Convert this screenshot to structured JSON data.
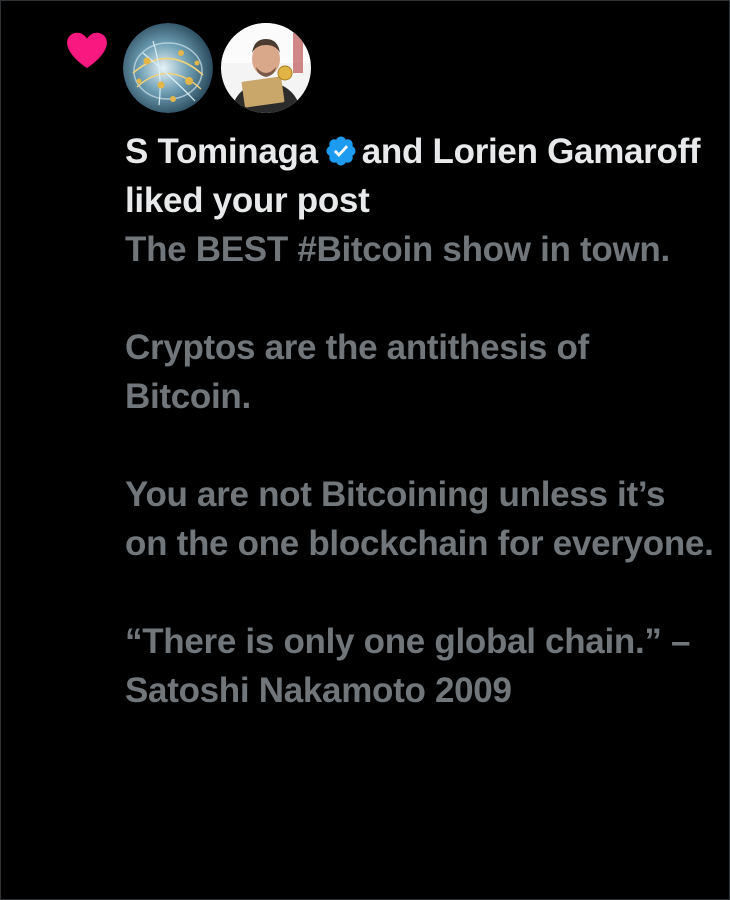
{
  "notification": {
    "type_icon": "heart-icon",
    "avatars": [
      {
        "icon": "globe-network-avatar"
      },
      {
        "icon": "person-avatar"
      }
    ],
    "user1": "S Tominaga",
    "verified_icon": "verified-badge-icon",
    "connector": "and",
    "user2": "Lorien Gamaroff",
    "action": "liked your post"
  },
  "post": {
    "paragraphs": [
      "The BEST #Bitcoin show in town.",
      "Cryptos are the antithesis of Bitcoin.",
      "You are not Bitcoining unless it’s on the one blockchain for everyone.",
      "“There is only one global chain.” – Satoshi Nakamoto 2009"
    ]
  },
  "colors": {
    "background": "#000000",
    "heart": "#f91880",
    "primary_text": "#e7e9ea",
    "secondary_text": "#71767b",
    "verified": "#1d9bf0"
  }
}
